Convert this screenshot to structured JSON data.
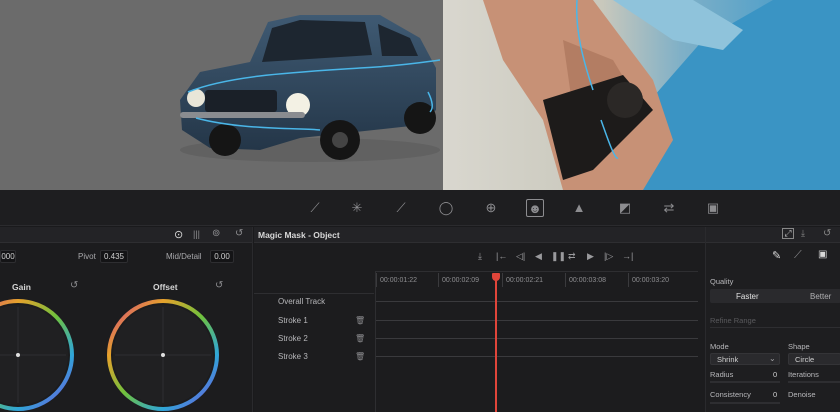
{
  "colors": {
    "accent_red": "#e0453a",
    "bg": "#1a1a1c",
    "panel": "#1c1c1e",
    "track_line": "#3a3a3d",
    "mask_stroke": "#4ab6e8"
  },
  "toolbar": {
    "icons": [
      "curves-icon",
      "warper-icon",
      "qualifier-picker-icon",
      "window-icon",
      "tracker-icon",
      "magic-mask-icon",
      "blur-icon",
      "key-icon",
      "sizing-icon",
      "3d-icon"
    ]
  },
  "primaries": {
    "first_value": "000",
    "pivot_label": "Pivot",
    "pivot_value": "0.435",
    "middetail_label": "Mid/Detail",
    "middetail_value": "0.00",
    "wheels": [
      {
        "label": "Gain"
      },
      {
        "label": "Offset"
      }
    ]
  },
  "magic_mask": {
    "title": "Magic Mask - Object",
    "timecodes": [
      "00:00:01:22",
      "00:00:02:09",
      "00:00:02:21",
      "00:00:03:08",
      "00:00:03:20"
    ],
    "tracks": [
      {
        "label": "Overall Track",
        "deletable": false
      },
      {
        "label": "Stroke 1",
        "deletable": true
      },
      {
        "label": "Stroke 2",
        "deletable": true
      },
      {
        "label": "Stroke 3",
        "deletable": true
      }
    ]
  },
  "settings": {
    "quality_label": "Quality",
    "quality_options": [
      "Faster",
      "Better"
    ],
    "quality_selected": "Faster",
    "refine_range_label": "Refine Range",
    "mode_label": "Mode",
    "mode_value": "Shrink",
    "shape_label": "Shape",
    "shape_value": "Circle",
    "radius_label": "Radius",
    "radius_value": "0",
    "iterations_label": "Iterations",
    "consistency_label": "Consistency",
    "consistency_value": "0",
    "denoise_label": "Denoise"
  }
}
